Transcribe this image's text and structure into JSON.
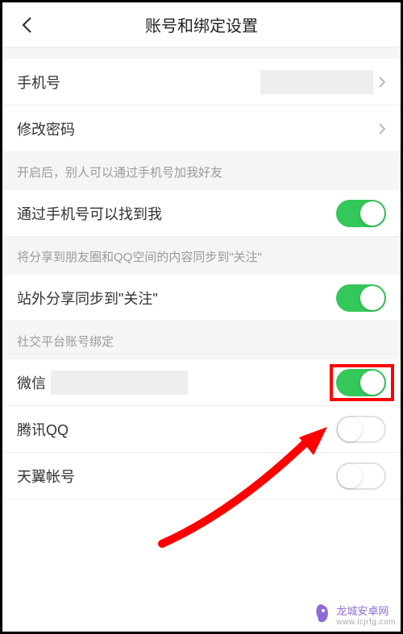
{
  "header": {
    "title": "账号和绑定设置"
  },
  "rows": {
    "phone": {
      "label": "手机号"
    },
    "changePassword": {
      "label": "修改密码"
    }
  },
  "sections": {
    "findByPhoneDesc": "开启后，别人可以通过手机号加我好友",
    "findByPhoneRow": {
      "label": "通过手机号可以找到我",
      "on": true
    },
    "syncDesc": "将分享到朋友圈和QQ空间的内容同步到\"关注\"",
    "syncRow": {
      "label": "站外分享同步到\"关注\"",
      "on": true
    },
    "socialHeader": "社交平台账号绑定",
    "wechat": {
      "label": "微信",
      "on": true
    },
    "qq": {
      "label": "腾讯QQ",
      "on": false
    },
    "tianyi": {
      "label": "天翼帐号",
      "on": false
    }
  },
  "watermark": {
    "name": "龙城安卓网",
    "url": "www.lcjrfg.com"
  }
}
